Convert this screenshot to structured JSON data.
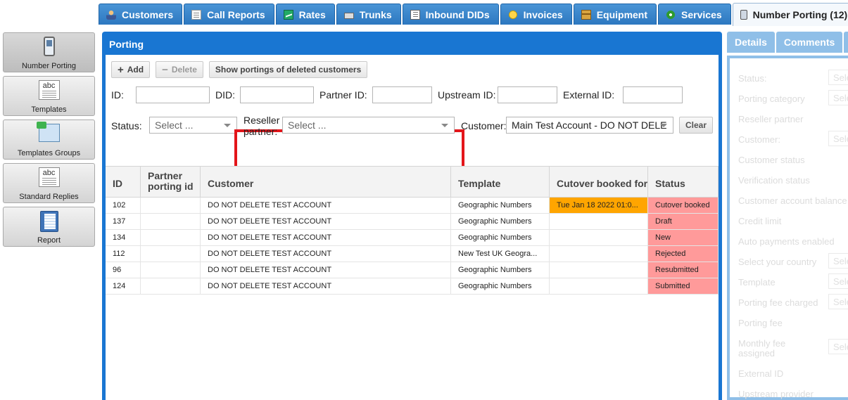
{
  "top_tabs": [
    {
      "label": "Customers",
      "icon": "person-icon"
    },
    {
      "label": "Call Reports",
      "icon": "call-report-icon"
    },
    {
      "label": "Rates",
      "icon": "rates-icon"
    },
    {
      "label": "Trunks",
      "icon": "trunks-icon"
    },
    {
      "label": "Inbound DIDs",
      "icon": "inbound-dids-icon"
    },
    {
      "label": "Invoices",
      "icon": "coins-icon"
    },
    {
      "label": "Equipment",
      "icon": "box-icon"
    },
    {
      "label": "Services",
      "icon": "services-icon"
    },
    {
      "label": "Number Porting (12)",
      "icon": "phone-icon",
      "active": true
    }
  ],
  "sidebar": {
    "items": [
      {
        "label": "Number Porting",
        "icon": "phone-icon"
      },
      {
        "label": "Templates",
        "icon": "abc-document-icon"
      },
      {
        "label": "Templates Groups",
        "icon": "envelope-icon"
      },
      {
        "label": "Standard Replies",
        "icon": "abc-document-icon"
      },
      {
        "label": "Report",
        "icon": "notebook-icon"
      }
    ]
  },
  "panel": {
    "title": "Porting",
    "toolbar": {
      "add_label": "Add",
      "delete_label": "Delete",
      "show_deleted_label": "Show portings of deleted customers"
    },
    "filters": {
      "id_label": "ID:",
      "did_label": "DID:",
      "partner_id_label": "Partner ID:",
      "upstream_id_label": "Upstream ID:",
      "external_id_label": "External ID:",
      "status_label": "Status:",
      "status_placeholder": "Select ...",
      "reseller_label_line1": "Reseller",
      "reseller_label_line2": "partner:",
      "reseller_placeholder": "Select ...",
      "customer_label": "Customer:",
      "customer_value": "Main Test Account - DO NOT DELE",
      "clear_label": "Clear"
    },
    "grid": {
      "columns": {
        "id": "ID",
        "partner_line1": "Partner",
        "partner_line2": "porting id",
        "customer": "Customer",
        "template": "Template",
        "cutover": "Cutover booked for..",
        "status": "Status"
      },
      "rows": [
        {
          "id": "102",
          "partner": "",
          "customer": "DO NOT DELETE TEST ACCOUNT",
          "template": "Geographic Numbers",
          "cutover": "Tue Jan 18 2022 01:0...",
          "status": "Cutover booked"
        },
        {
          "id": "137",
          "partner": "",
          "customer": "DO NOT DELETE TEST ACCOUNT",
          "template": "Geographic Numbers",
          "cutover": "",
          "status": "Draft"
        },
        {
          "id": "134",
          "partner": "",
          "customer": "DO NOT DELETE TEST ACCOUNT",
          "template": "Geographic Numbers",
          "cutover": "",
          "status": "New"
        },
        {
          "id": "112",
          "partner": "",
          "customer": "DO NOT DELETE TEST ACCOUNT",
          "template": "New Test UK Geogra...",
          "cutover": "",
          "status": "Rejected"
        },
        {
          "id": "96",
          "partner": "",
          "customer": "DO NOT DELETE TEST ACCOUNT",
          "template": "Geographic Numbers",
          "cutover": "",
          "status": "Resubmitted"
        },
        {
          "id": "124",
          "partner": "",
          "customer": "DO NOT DELETE TEST ACCOUNT",
          "template": "Geographic Numbers",
          "cutover": "",
          "status": "Submitted"
        }
      ]
    }
  },
  "right_panel": {
    "tabs": [
      "Details",
      "Comments"
    ],
    "fields": [
      {
        "label": "Status:",
        "box": "Sele"
      },
      {
        "label": "Porting category",
        "box": "Sele"
      },
      {
        "label": "Reseller partner",
        "box": ""
      },
      {
        "label": "Customer:",
        "box": "Sele"
      },
      {
        "label": "Customer status",
        "box": ""
      },
      {
        "label": "Verification status",
        "box": ""
      },
      {
        "label": "Customer account balance",
        "box": ""
      },
      {
        "label": "Credit limit",
        "box": ""
      },
      {
        "label": "Auto payments enabled",
        "box": ""
      },
      {
        "label": "Select your country",
        "box": "Sele"
      },
      {
        "label": "Template",
        "box": "Sele"
      },
      {
        "label": "Porting fee charged",
        "box": "Sele"
      },
      {
        "label": "Porting fee",
        "box": ""
      },
      {
        "label": "Monthly fee",
        "box": "Sele"
      },
      {
        "label": "assigned",
        "box": ""
      },
      {
        "label": "External ID",
        "box": ""
      },
      {
        "label": "Upstream provider",
        "box": ""
      }
    ]
  },
  "colors": {
    "accent": "#1976d2",
    "cutover_highlight": "#ffa500",
    "status_highlight": "#ff9a9a",
    "annotation_red": "#e3151a"
  }
}
